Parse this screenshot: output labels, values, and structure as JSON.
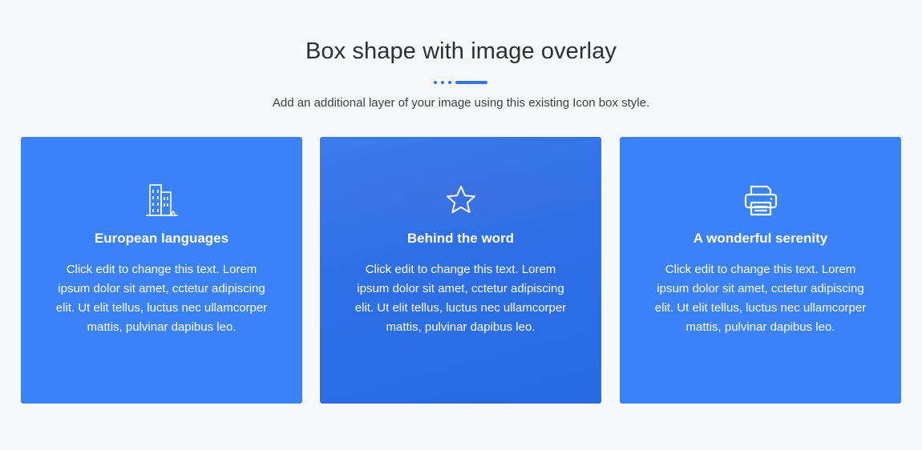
{
  "section": {
    "title": "Box shape with image overlay",
    "subtitle": "Add an additional layer of your image using this existing Icon box style."
  },
  "cards": [
    {
      "icon": "building-icon",
      "title": "European languages",
      "text": "Click edit to change this text. Lorem ipsum dolor sit amet, cctetur adipiscing elit. Ut elit tellus, luctus nec ullamcorper mattis, pulvinar dapibus leo."
    },
    {
      "icon": "star-icon",
      "title": "Behind the word",
      "text": "Click edit to change this text. Lorem ipsum dolor sit amet, cctetur adipiscing elit. Ut elit tellus, luctus nec ullamcorper mattis, pulvinar dapibus leo."
    },
    {
      "icon": "printer-icon",
      "title": "A wonderful serenity",
      "text": "Click edit to change this text. Lorem ipsum dolor sit amet, cctetur adipiscing elit. Ut elit tellus, luctus nec ullamcorper mattis, pulvinar dapibus leo."
    }
  ],
  "colors": {
    "accent": "#2f74f0",
    "card_background": "#3b82f8",
    "page_background": "#f7f8fa"
  }
}
